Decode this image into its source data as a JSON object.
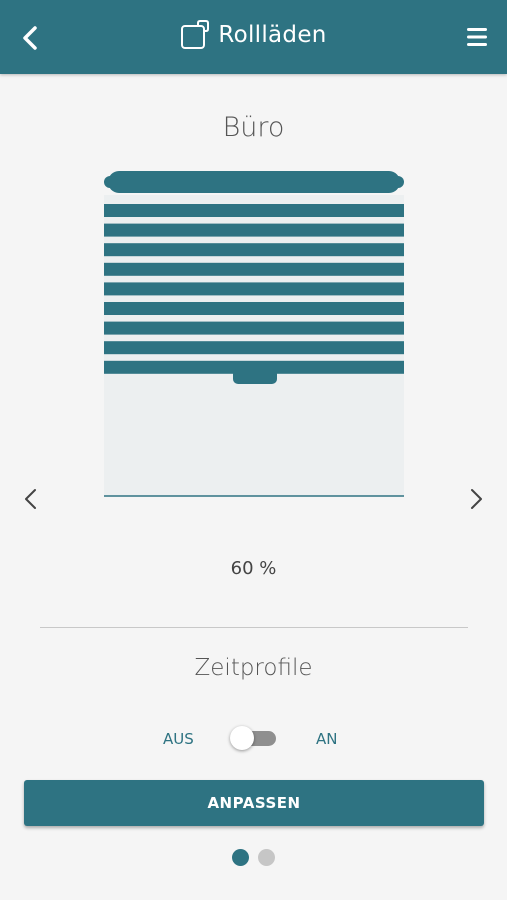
{
  "header": {
    "title": "Rollläden",
    "title_icon": "window-icon",
    "back_icon": "chevron-left-icon",
    "menu_icon": "hamburger-menu-icon"
  },
  "room": {
    "name": "Büro"
  },
  "shutter": {
    "position_percent": 60,
    "position_label": "60 %",
    "slat_count": 9
  },
  "zeitprofile": {
    "title": "Zeitprofile",
    "off_label": "AUS",
    "on_label": "AN",
    "enabled": false
  },
  "actions": {
    "adjust_label": "ANPASSEN"
  },
  "pager": {
    "pages": 2,
    "current": 1
  },
  "colors": {
    "accent": "#2e7382",
    "background": "#f5f5f5",
    "window_pane": "#eceff0",
    "toggle_track": "#8f8f8f",
    "dot_inactive": "#c6c6c6"
  }
}
